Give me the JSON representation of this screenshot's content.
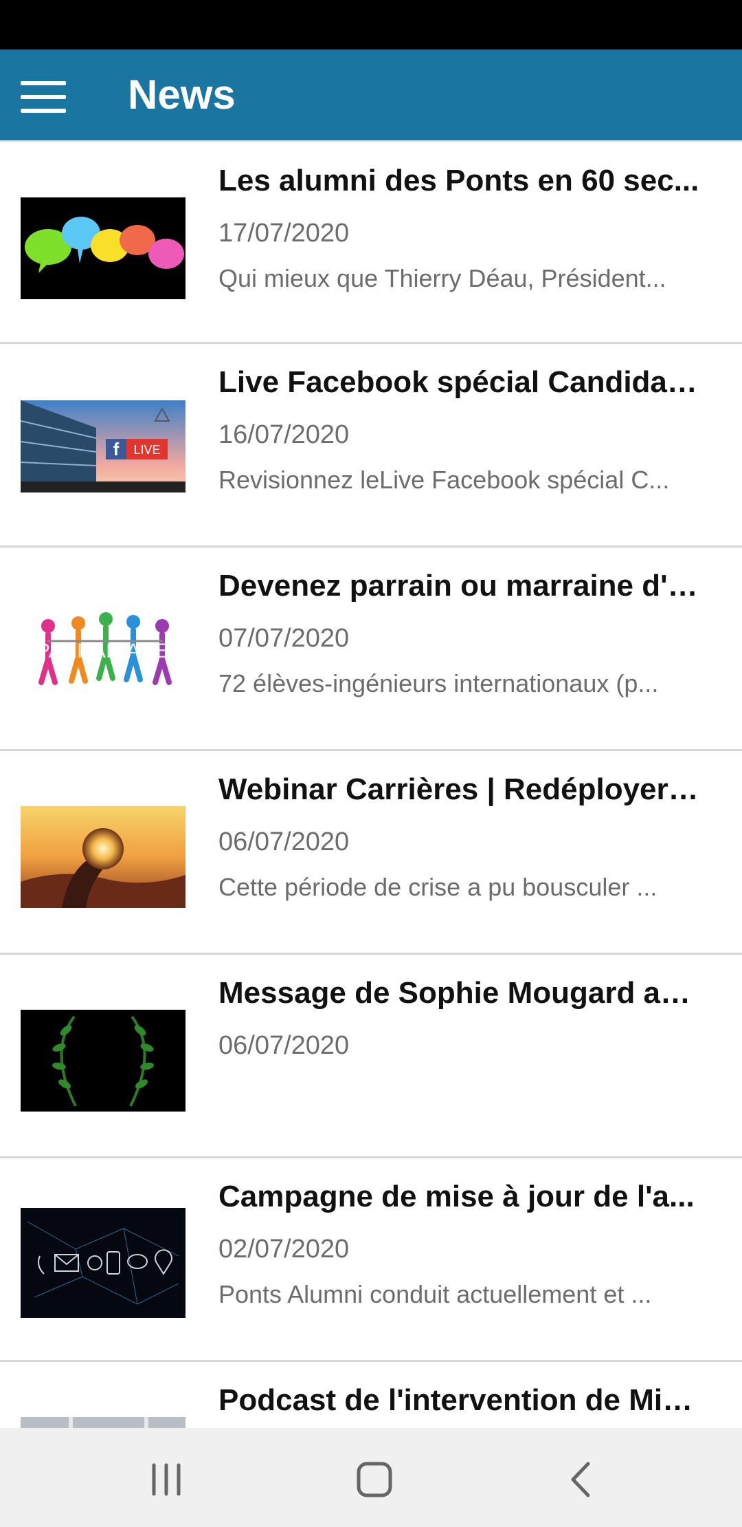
{
  "header": {
    "title": "News"
  },
  "news": [
    {
      "title": "Les alumni des Ponts en 60 sec...",
      "date": "17/07/2020",
      "desc": "Qui mieux que Thierry Déau, Président...",
      "thumb": "speech-bubbles-thumbnail"
    },
    {
      "title": "Live Facebook spécial Candidat...",
      "date": "16/07/2020",
      "desc": "Revisionnez leLive Facebook spécial C...",
      "thumb": "facebook-live-thumbnail",
      "thumb_text": "LIVE"
    },
    {
      "title": "Devenez parrain ou marraine d'u...",
      "date": "07/07/2020",
      "desc": "72 élèves-ingénieurs internationaux (p...",
      "thumb": "parrainage-people-thumbnail",
      "thumb_text": "PARRAINAGE"
    },
    {
      "title": "Webinar Carrières | Redéployer ...",
      "date": "06/07/2020",
      "desc": "Cette période de crise a pu bousculer ...",
      "thumb": "crystal-ball-sunset-thumbnail"
    },
    {
      "title": "Message de Sophie Mougard au...",
      "date": "06/07/2020",
      "desc": "",
      "thumb": "laurel-wreath-thumbnail"
    },
    {
      "title": "Campagne de mise à jour de l'a...",
      "date": "02/07/2020",
      "desc": "Ponts Alumni conduit actuellement et ...",
      "thumb": "contact-network-thumbnail"
    },
    {
      "title": "Podcast de l'intervention de Mic...",
      "date": "",
      "desc": "",
      "thumb": "podcast-thumbnail"
    }
  ],
  "colors": {
    "app_bar": "#1a76a0",
    "status_bar": "#000000",
    "nav_bar": "#f0f0f0"
  },
  "icons": {
    "menu": "hamburger-menu-icon",
    "recents": "recent-apps-icon",
    "home": "home-icon",
    "back": "back-icon"
  }
}
